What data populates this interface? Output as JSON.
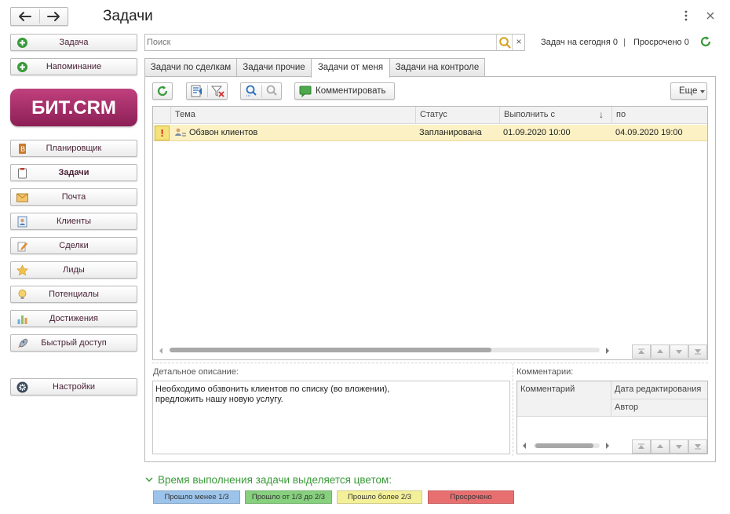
{
  "window": {
    "title": "Задачи"
  },
  "topbar": {
    "today_label": "Задач на сегодня 0",
    "separator": "|",
    "overdue_label": "Просрочено 0"
  },
  "search": {
    "placeholder": "Поиск",
    "clear": "×"
  },
  "sidebar": {
    "create_task": "Задача",
    "create_reminder": "Напоминание",
    "logo_text": "БИТ.CRM",
    "items": [
      {
        "label": "Планировщик"
      },
      {
        "label": "Задачи"
      },
      {
        "label": "Почта"
      },
      {
        "label": "Клиенты"
      },
      {
        "label": "Сделки"
      },
      {
        "label": "Лиды"
      },
      {
        "label": "Потенциалы"
      },
      {
        "label": "Достижения"
      },
      {
        "label": "Быстрый доступ"
      }
    ],
    "settings": "Настройки"
  },
  "tabs": [
    {
      "label": "Задачи по сделкам"
    },
    {
      "label": "Задачи прочие"
    },
    {
      "label": "Задачи от меня"
    },
    {
      "label": "Задачи на контроле"
    }
  ],
  "toolbar": {
    "comment_label": "Комментировать",
    "more_label": "Еще"
  },
  "table": {
    "columns": [
      "Тема",
      "Статус",
      "Выполнить с",
      "по"
    ],
    "sort_arrow": "↓",
    "rows": [
      {
        "flag": "!",
        "subject": "Обзвон клиентов",
        "status": "Запланирована",
        "from": "01.09.2020 10:00",
        "to": "04.09.2020 19:00"
      }
    ]
  },
  "details": {
    "label": "Детальное описание:",
    "text_line1": "Необходимо обзвонить клиентов по списку (во вложении),",
    "text_line2": "предложить нашу новую услугу."
  },
  "comments": {
    "label": "Комментарии:",
    "col_comment": "Комментарий",
    "col_date": "Дата редактирования",
    "col_author": "Автор"
  },
  "legend": {
    "title": "Время выполнения задачи выделяется цветом:",
    "items": [
      {
        "label": "Прошло менее 1/3",
        "color": "#9cc3ea"
      },
      {
        "label": "Прошло от 1/3 до 2/3",
        "color": "#86d07e"
      },
      {
        "label": "Прошло более 2/3",
        "color": "#f4f09a"
      },
      {
        "label": "Просрочено",
        "color": "#e86f70"
      }
    ]
  },
  "colors": {
    "accent_green": "#3a9a3a",
    "brand": "#9e2a63",
    "row_highlight": "#fbf1c4"
  }
}
